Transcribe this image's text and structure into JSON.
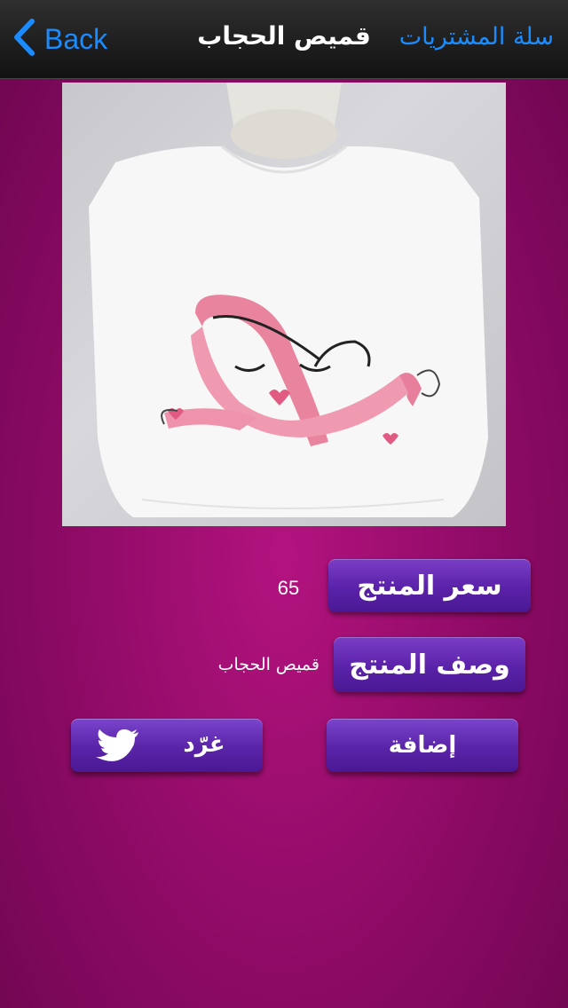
{
  "nav": {
    "back_label": "Back",
    "title": "قميص الحجاب",
    "cart_label": "سلة المشتريات"
  },
  "product": {
    "price_label": "سعر المنتج",
    "price_value": "65",
    "description_label": "وصف المنتج",
    "description_value": "قميص الحجاب"
  },
  "actions": {
    "add_label": "إضافة",
    "tweet_label": "غرّد"
  },
  "icons": {
    "back": "chevron-left-icon",
    "tweet": "twitter-bird-icon"
  },
  "colors": {
    "nav_link": "#1a8cff",
    "background": "#8c0a64",
    "button": "#5a22a8"
  }
}
